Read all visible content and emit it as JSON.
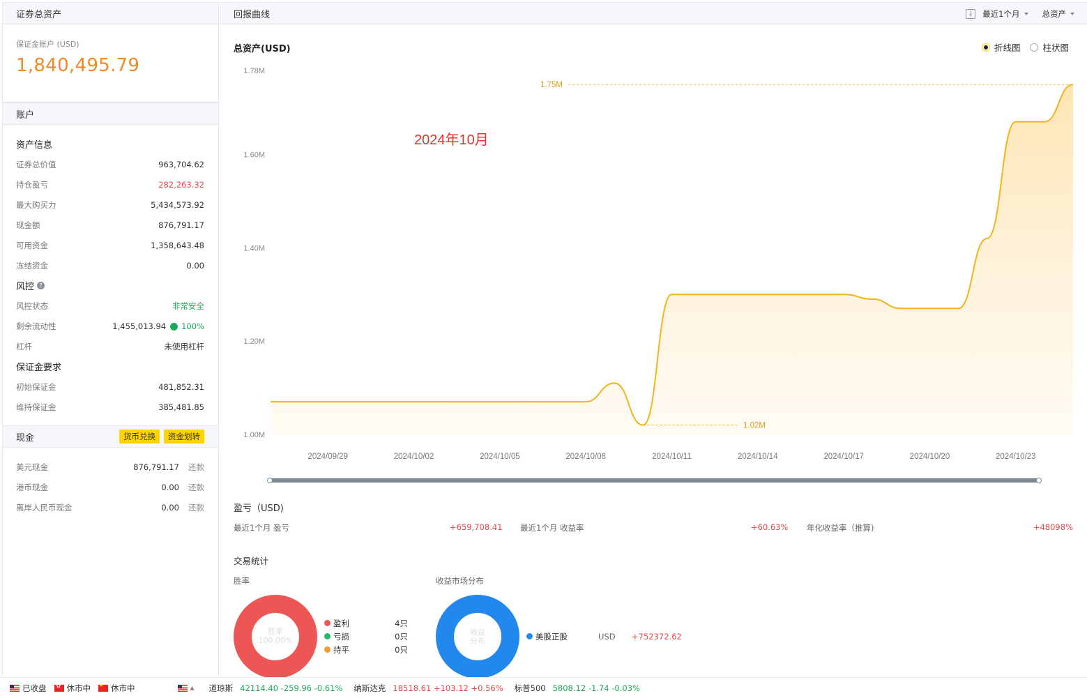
{
  "left": {
    "header_title": "证券总资产",
    "account_label": "保证金账户 (USD)",
    "total_value": "1,840,495.79",
    "account_section": "账户",
    "asset_info_title": "资产信息",
    "asset_rows": [
      {
        "label": "证券总价值",
        "value": "963,704.62"
      },
      {
        "label": "持仓盈亏",
        "value": "282,263.32"
      },
      {
        "label": "最大购买力",
        "value": "5,434,573.92"
      },
      {
        "label": "现金额",
        "value": "876,791.17"
      },
      {
        "label": "可用资金",
        "value": "1,358,643.48"
      },
      {
        "label": "冻结资金",
        "value": "0.00"
      }
    ],
    "risk_title": "风控",
    "risk_help": "?",
    "risk_status_label": "风控状态",
    "risk_status_value": "非常安全",
    "liquidity_label": "剩余流动性",
    "liquidity_value": "1,455,013.94",
    "liquidity_pct": "100%",
    "leverage_label": "杠杆",
    "leverage_value": "未使用杠杆",
    "margin_title": "保证金要求",
    "margin_rows": [
      {
        "label": "初始保证金",
        "value": "481,852.31"
      },
      {
        "label": "维持保证金",
        "value": "385,481.85"
      }
    ],
    "cash_title": "现金",
    "fx_button": "货币兑换",
    "transfer_button": "资金划转",
    "cash_rows": [
      {
        "label": "美元现金",
        "value": "876,791.17",
        "action": "还款"
      },
      {
        "label": "港币现金",
        "value": "0.00",
        "action": "还款"
      },
      {
        "label": "离岸人民币现金",
        "value": "0.00",
        "action": "还款"
      }
    ]
  },
  "right": {
    "header_title": "回报曲线",
    "download_icon": "download-icon",
    "period_select": "最近1个月",
    "metric_select": "总资产",
    "chart_title": "总资产(USD)",
    "toggle_line": "折线图",
    "toggle_bar": "柱状图",
    "month_annotation": "2024年10月",
    "max_label": "1.75M",
    "min_label": "1.02M",
    "pl_title": "盈亏（USD)",
    "pl_items": [
      {
        "label": "最近1个月 盈亏",
        "value": "+659,708.41"
      },
      {
        "label": "最近1个月 收益率",
        "value": "+60.63%"
      },
      {
        "label": "年化收益率（推算)",
        "value": "+48098%"
      }
    ],
    "trade_title": "交易统计",
    "winrate_label": "胜率",
    "winrate_center_1": "胜率",
    "winrate_center_2": "100.00%",
    "winrate_legend": [
      {
        "label": "盈利",
        "count": "4只",
        "color": "#ee5555"
      },
      {
        "label": "亏损",
        "count": "0只",
        "color": "#22bb66"
      },
      {
        "label": "持平",
        "count": "0只",
        "color": "#f39c33"
      }
    ],
    "market_label": "收益市场分布",
    "market_center_1": "收益",
    "market_center_2": "分布",
    "market_legend": {
      "label": "美股正股",
      "currency": "USD",
      "value": "+752372.62",
      "color": "#2288ee"
    }
  },
  "chart_data": {
    "type": "area",
    "title": "总资产(USD)",
    "x": [
      "2024/09/27",
      "2024/09/28",
      "2024/09/29",
      "2024/09/30",
      "2024/10/01",
      "2024/10/02",
      "2024/10/03",
      "2024/10/04",
      "2024/10/05",
      "2024/10/06",
      "2024/10/07",
      "2024/10/08",
      "2024/10/09",
      "2024/10/10",
      "2024/10/11",
      "2024/10/12",
      "2024/10/13",
      "2024/10/14",
      "2024/10/15",
      "2024/10/16",
      "2024/10/17",
      "2024/10/18",
      "2024/10/19",
      "2024/10/20",
      "2024/10/21",
      "2024/10/22",
      "2024/10/23",
      "2024/10/24",
      "2024/10/25"
    ],
    "values": [
      1.07,
      1.07,
      1.07,
      1.07,
      1.07,
      1.07,
      1.07,
      1.07,
      1.07,
      1.07,
      1.07,
      1.07,
      1.11,
      1.02,
      1.3,
      1.3,
      1.3,
      1.3,
      1.3,
      1.3,
      1.3,
      1.29,
      1.27,
      1.27,
      1.27,
      1.42,
      1.67,
      1.67,
      1.75
    ],
    "xticks": [
      "2024/09/29",
      "2024/10/02",
      "2024/10/05",
      "2024/10/08",
      "2024/10/11",
      "2024/10/14",
      "2024/10/17",
      "2024/10/20",
      "2024/10/23"
    ],
    "yticks": [
      "1.00M",
      "1.20M",
      "1.40M",
      "1.60M",
      "1.78M"
    ],
    "ylim": [
      1.0,
      1.78
    ],
    "max": 1.75,
    "min": 1.02,
    "color": "#f0b41e"
  },
  "status": {
    "us_state": "已收盘",
    "hk_state": "休市中",
    "cn_state": "休市中",
    "indices": [
      {
        "name": "道琼斯",
        "value": "42114.40 -259.96 -0.61%",
        "trend": "down"
      },
      {
        "name": "纳斯达克",
        "value": "18518.61 +103.12 +0.56%",
        "trend": "up"
      },
      {
        "name": "标普500",
        "value": "5808.12 -1.74 -0.03%",
        "trend": "down"
      }
    ]
  }
}
